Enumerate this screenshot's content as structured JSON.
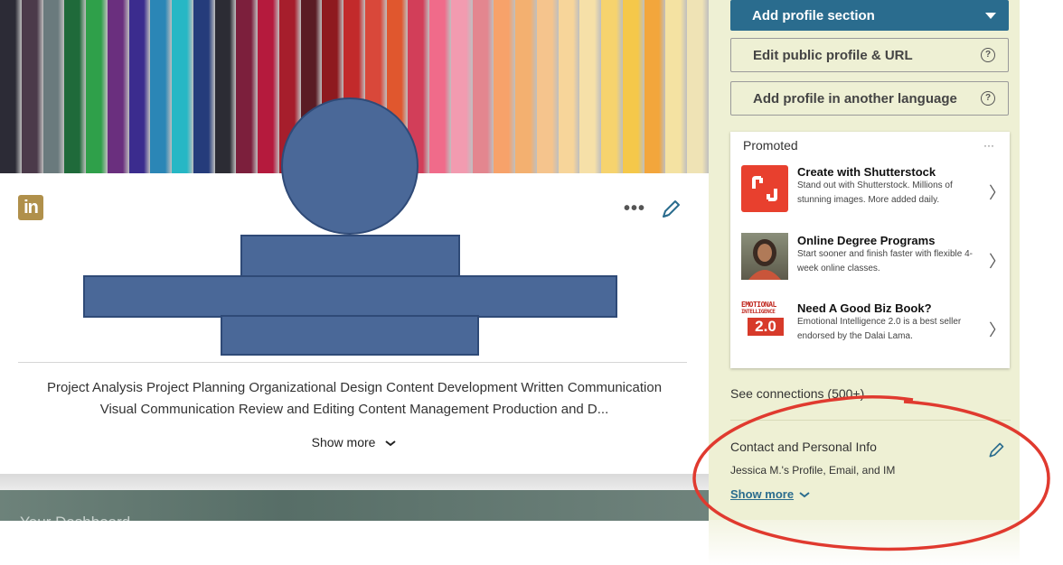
{
  "colors": {
    "accent": "#2a6c8e",
    "linkedin_logo": "#b0904b",
    "avatar_fill": "#4a6898",
    "annotation_circle": "#e03a2f",
    "sidebar_bg": "#eef0d4",
    "banner_pencils": [
      "#2c2b36",
      "#4b3a4a",
      "#6a7a7d",
      "#1f6a3a",
      "#2fa04a",
      "#6a2f7e",
      "#3b2c8e",
      "#2b86b6",
      "#26b7c5",
      "#253c7b",
      "#2c2c34",
      "#7c1f3c",
      "#b51a3d",
      "#a61e2c",
      "#5a1c24",
      "#8e1a1f",
      "#c22a2b",
      "#d9483a",
      "#e0572e",
      "#d23e59",
      "#f06b8a",
      "#f29bb0",
      "#e3868f",
      "#f7a26a",
      "#f3b070",
      "#f5c48d",
      "#f7d59a",
      "#f6e0a8",
      "#f6d36e",
      "#f5c84a",
      "#f3a63c",
      "#f4e2a2",
      "#efe3b5"
    ]
  },
  "header": {
    "logo_text": "in",
    "more_icon": "more-horizontal-icon",
    "edit_icon": "pencil-icon"
  },
  "profile": {
    "skills_line1": "Project Analysis Project Planning Organizational Design Content Development Written Communication",
    "skills_line2": "Visual Communication Review and Editing Content Management Production and D...",
    "show_more": "Show more"
  },
  "dashboard": {
    "title": "Your Dashboard"
  },
  "sidebar": {
    "add_section_label": "Add profile section",
    "edit_public_label": "Edit public profile & URL",
    "add_language_label": "Add profile in another language",
    "help_glyph": "?"
  },
  "promoted": {
    "label": "Promoted",
    "menu": "···",
    "ads": [
      {
        "title": "Create with Shutterstock",
        "desc": "Stand out with Shutterstock. Millions of stunning images. More added daily."
      },
      {
        "title": "Online Degree Programs",
        "desc": "Start sooner and finish faster with flexible 4-week online classes."
      },
      {
        "title": "Need A Good Biz Book?",
        "desc": "Emotional Intelligence 2.0 is a best seller endorsed by the Dalai Lama.",
        "cover_line1": "EMOTIONAL",
        "cover_line2": "INTELLIGENCE",
        "cover_line3": "2.0"
      }
    ]
  },
  "connections": {
    "label": "See connections (500+)"
  },
  "contact": {
    "title": "Contact and Personal Info",
    "subtitle": "Jessica M.'s Profile, Email, and IM",
    "show_more": "Show more"
  }
}
